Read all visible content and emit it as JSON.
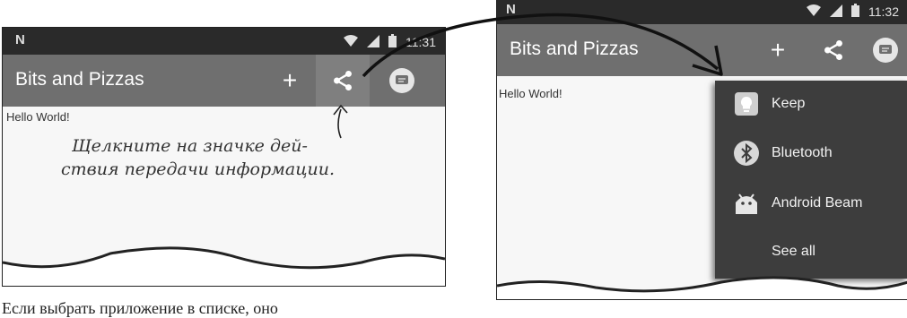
{
  "left_screen": {
    "status": {
      "time": "11:31"
    },
    "app_bar": {
      "title": "Bits and Pizzas",
      "add_label": "+"
    },
    "content": {
      "hello_text": "Hello World!"
    }
  },
  "right_screen": {
    "status": {
      "time": "11:32"
    },
    "app_bar": {
      "title": "Bits and Pizzas",
      "add_label": "+"
    },
    "content": {
      "hello_text": "Hello World!"
    },
    "share_menu": {
      "items": [
        {
          "label": "Keep",
          "icon": "keep-icon"
        },
        {
          "label": "Bluetooth",
          "icon": "bluetooth-icon"
        },
        {
          "label": "Android Beam",
          "icon": "android-icon"
        },
        {
          "label": "See all"
        }
      ]
    }
  },
  "annotation": {
    "line1": "Щелкните на значке дей-",
    "line2": "ствия передачи информации."
  },
  "page_text": {
    "bottom": "Если выбрать приложение в списке, оно"
  },
  "colors": {
    "status_bar": "#2a2a2a",
    "app_bar": "#6f6f6f",
    "menu_bg": "#3d3d3d",
    "content_bg": "#f7f7f7"
  }
}
